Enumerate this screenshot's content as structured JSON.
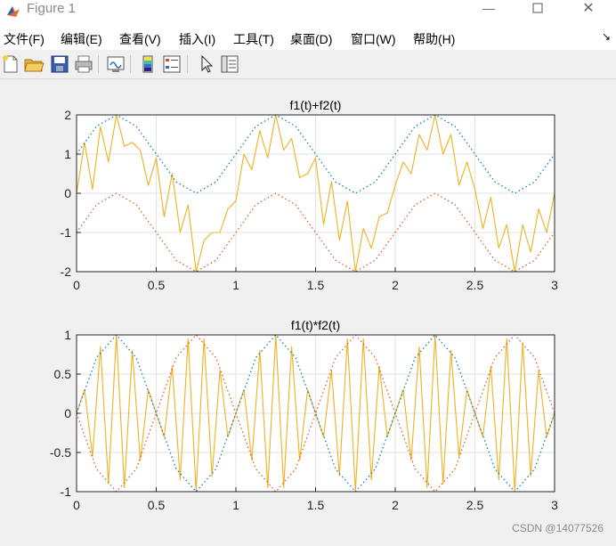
{
  "window": {
    "title": "Figure 1",
    "minimize_icon": "minimize-icon",
    "maximize_icon": "maximize-icon",
    "close_icon": "close-icon"
  },
  "menu": {
    "items": [
      "文件(F)",
      "编辑(E)",
      "查看(V)",
      "插入(I)",
      "工具(T)",
      "桌面(D)",
      "窗口(W)",
      "帮助(H)"
    ],
    "dock_icon": "dock-arrow-icon"
  },
  "toolbar": {
    "buttons": [
      {
        "icon": "new-figure-icon"
      },
      {
        "icon": "open-file-icon"
      },
      {
        "icon": "save-icon"
      },
      {
        "icon": "print-icon"
      },
      {
        "icon": "link-plot-icon"
      },
      {
        "icon": "colorbar-icon"
      },
      {
        "icon": "legend-icon"
      },
      {
        "icon": "pointer-icon"
      },
      {
        "icon": "property-inspector-icon"
      }
    ]
  },
  "colors": {
    "signal": "#EDB120",
    "upper_envelope": "#0072BD",
    "lower_envelope": "#D95319"
  },
  "chart_data": [
    {
      "type": "line",
      "title": "f1(t)+f2(t)",
      "xlim": [
        0,
        3
      ],
      "ylim": [
        -2,
        2
      ],
      "xticks": [
        "0",
        "0.5",
        "1",
        "1.5",
        "2",
        "2.5",
        "3"
      ],
      "yticks": [
        "2",
        "1",
        "0",
        "-1",
        "-2"
      ],
      "grid": true,
      "series": [
        {
          "role": "signal",
          "style": "solid",
          "x": [
            0,
            0.05,
            0.1,
            0.15,
            0.2,
            0.25,
            0.3,
            0.35,
            0.4,
            0.45,
            0.5,
            0.55,
            0.6,
            0.65,
            0.7,
            0.75,
            0.8,
            0.85,
            0.9,
            0.95,
            1.0,
            1.05,
            1.1,
            1.15,
            1.2,
            1.25,
            1.3,
            1.35,
            1.4,
            1.45,
            1.5,
            1.55,
            1.6,
            1.65,
            1.7,
            1.75,
            1.8,
            1.85,
            1.9,
            1.95,
            2.0,
            2.05,
            2.1,
            2.15,
            2.2,
            2.25,
            2.3,
            2.35,
            2.4,
            2.45,
            2.5,
            2.55,
            2.6,
            2.65,
            2.7,
            2.75,
            2.8,
            2.85,
            2.9,
            2.95,
            3.0
          ],
          "y": [
            0,
            1.3,
            0.1,
            1.7,
            0.8,
            2.0,
            1.2,
            1.3,
            1.1,
            0.2,
            0.9,
            -0.6,
            0.5,
            -1.0,
            -0.3,
            -2.0,
            -1.2,
            -1.0,
            -1.0,
            -0.4,
            -0.2,
            1.0,
            0.6,
            1.6,
            0.9,
            2.0,
            1.1,
            1.4,
            0.4,
            0.5,
            0.9,
            -0.8,
            0.3,
            -1.2,
            -0.2,
            -2.0,
            -0.9,
            -1.4,
            -0.6,
            -0.5,
            0.2,
            0.8,
            0.5,
            1.5,
            1.1,
            2.0,
            1.0,
            1.5,
            0.2,
            0.8,
            0.1,
            -0.9,
            -0.1,
            -1.4,
            -0.8,
            -2.0,
            -0.8,
            -1.5,
            -0.4,
            -1.0,
            0.0
          ]
        },
        {
          "role": "upper_envelope",
          "style": "dotted",
          "x": [
            0,
            0.125,
            0.25,
            0.375,
            0.5,
            0.625,
            0.75,
            0.875,
            1.0,
            1.125,
            1.25,
            1.375,
            1.5,
            1.625,
            1.75,
            1.875,
            2.0,
            2.125,
            2.25,
            2.375,
            2.5,
            2.625,
            2.75,
            2.875,
            3.0
          ],
          "y": [
            1.0,
            1.71,
            2.0,
            1.71,
            1.0,
            0.29,
            0.0,
            0.29,
            1.0,
            1.71,
            2.0,
            1.71,
            1.0,
            0.29,
            0.0,
            0.29,
            1.0,
            1.71,
            2.0,
            1.71,
            1.0,
            0.29,
            0.0,
            0.29,
            1.0
          ]
        },
        {
          "role": "lower_envelope",
          "style": "dotted",
          "x": [
            0,
            0.125,
            0.25,
            0.375,
            0.5,
            0.625,
            0.75,
            0.875,
            1.0,
            1.125,
            1.25,
            1.375,
            1.5,
            1.625,
            1.75,
            1.875,
            2.0,
            2.125,
            2.25,
            2.375,
            2.5,
            2.625,
            2.75,
            2.875,
            3.0
          ],
          "y": [
            -1.0,
            -0.29,
            0.0,
            -0.29,
            -1.0,
            -1.71,
            -2.0,
            -1.71,
            -1.0,
            -0.29,
            0.0,
            -0.29,
            -1.0,
            -1.71,
            -2.0,
            -1.71,
            -1.0,
            -0.29,
            0.0,
            -0.29,
            -1.0,
            -1.71,
            -2.0,
            -1.71,
            -1.0
          ]
        }
      ]
    },
    {
      "type": "line",
      "title": "f1(t)*f2(t)",
      "xlim": [
        0,
        3
      ],
      "ylim": [
        -1,
        1
      ],
      "xticks": [
        "0",
        "0.5",
        "1",
        "1.5",
        "2",
        "2.5",
        "3"
      ],
      "yticks": [
        "1",
        "0.5",
        "0",
        "-0.5",
        "-1"
      ],
      "grid": true,
      "series": [
        {
          "role": "signal",
          "style": "solid",
          "x": [
            0,
            0.05,
            0.1,
            0.15,
            0.2,
            0.25,
            0.3,
            0.35,
            0.4,
            0.45,
            0.5,
            0.55,
            0.6,
            0.65,
            0.7,
            0.75,
            0.8,
            0.85,
            0.9,
            0.95,
            1.0,
            1.05,
            1.1,
            1.15,
            1.2,
            1.25,
            1.3,
            1.35,
            1.4,
            1.45,
            1.5,
            1.55,
            1.6,
            1.65,
            1.7,
            1.75,
            1.8,
            1.85,
            1.9,
            1.95,
            2.0,
            2.05,
            2.1,
            2.15,
            2.2,
            2.25,
            2.3,
            2.35,
            2.4,
            2.45,
            2.5,
            2.55,
            2.6,
            2.65,
            2.7,
            2.75,
            2.8,
            2.85,
            2.9,
            2.95,
            3.0
          ],
          "y": [
            0,
            0.3,
            -0.55,
            0.85,
            -0.9,
            1.0,
            -0.95,
            0.8,
            -0.6,
            0.3,
            0,
            -0.3,
            0.6,
            -0.85,
            0.95,
            -1.0,
            0.95,
            -0.8,
            0.55,
            -0.3,
            0,
            0.3,
            -0.6,
            0.8,
            -0.95,
            1.0,
            -0.95,
            0.85,
            -0.6,
            0.3,
            0,
            -0.3,
            0.55,
            -0.8,
            0.95,
            -1.0,
            0.95,
            -0.85,
            0.6,
            -0.3,
            0,
            0.3,
            -0.6,
            0.85,
            -0.95,
            1.0,
            -0.9,
            0.8,
            -0.55,
            0.3,
            0,
            -0.3,
            0.6,
            -0.85,
            0.95,
            -1.0,
            0.9,
            -0.8,
            0.55,
            -0.3,
            0
          ]
        },
        {
          "role": "upper_envelope",
          "style": "dotted",
          "x": [
            0,
            0.125,
            0.25,
            0.375,
            0.5,
            0.625,
            0.75,
            0.875,
            1.0,
            1.125,
            1.25,
            1.375,
            1.5,
            1.625,
            1.75,
            1.875,
            2.0,
            2.125,
            2.25,
            2.375,
            2.5,
            2.625,
            2.75,
            2.875,
            3.0
          ],
          "y": [
            0,
            0.71,
            1.0,
            0.71,
            0,
            -0.71,
            -1.0,
            -0.71,
            0,
            0.71,
            1.0,
            0.71,
            0,
            -0.71,
            -1.0,
            -0.71,
            0,
            0.71,
            1.0,
            0.71,
            0,
            -0.71,
            -1.0,
            -0.71,
            0
          ]
        },
        {
          "role": "lower_envelope",
          "style": "dotted",
          "x": [
            0,
            0.125,
            0.25,
            0.375,
            0.5,
            0.625,
            0.75,
            0.875,
            1.0,
            1.125,
            1.25,
            1.375,
            1.5,
            1.625,
            1.75,
            1.875,
            2.0,
            2.125,
            2.25,
            2.375,
            2.5,
            2.625,
            2.75,
            2.875,
            3.0
          ],
          "y": [
            0,
            -0.71,
            -1.0,
            -0.71,
            0,
            0.71,
            1.0,
            0.71,
            0,
            -0.71,
            -1.0,
            -0.71,
            0,
            0.71,
            1.0,
            0.71,
            0,
            -0.71,
            -1.0,
            -0.71,
            0,
            0.71,
            1.0,
            0.71,
            0
          ]
        }
      ]
    }
  ],
  "watermark": "CSDN @14077526"
}
